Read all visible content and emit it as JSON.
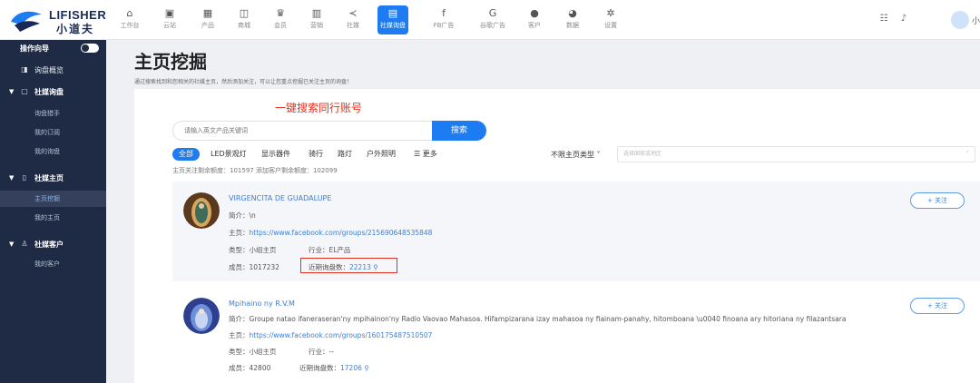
{
  "brand": {
    "name_en": "LIFISHER",
    "name_cn": "小道夫",
    "logo_color": "#1b2a55",
    "accent": "#1d7cf2"
  },
  "nav": [
    {
      "label": "工作台",
      "icon": "home-icon"
    },
    {
      "label": "云站",
      "icon": "monitor-icon"
    },
    {
      "label": "产品",
      "icon": "grid-icon"
    },
    {
      "label": "商城",
      "icon": "store-icon"
    },
    {
      "label": "会员",
      "icon": "crown-icon"
    },
    {
      "label": "营销",
      "icon": "bar-chart-icon"
    },
    {
      "label": "社媒",
      "icon": "share-icon"
    },
    {
      "label": "社媒询盘",
      "icon": "media-inquiry-icon",
      "active": true
    },
    {
      "label": "FB广告",
      "icon": "facebook-icon"
    },
    {
      "label": "谷歌广告",
      "icon": "google-icon"
    },
    {
      "label": "客户",
      "icon": "user-icon"
    },
    {
      "label": "数据",
      "icon": "pie-chart-icon"
    },
    {
      "label": "设置",
      "icon": "gear-icon"
    }
  ],
  "topright": {
    "avatar_name": "小"
  },
  "sidebar": {
    "guide_label": "操作向导",
    "overview": "询盘概览",
    "groups": [
      {
        "label": "社媒询盘",
        "items": [
          "询盘猎手",
          "我的订阅",
          "我的询盘"
        ]
      },
      {
        "label": "社媒主页",
        "items": [
          "主页挖掘",
          "我的主页"
        ],
        "active_item": "主页挖掘"
      },
      {
        "label": "社媒客户",
        "items": [
          "我的客户"
        ]
      }
    ]
  },
  "page": {
    "title": "主页挖掘",
    "description": "通过搜索找到和您相关的社媒主页，然后添加关注，可以让您重点挖掘已关注主页的询盘！"
  },
  "annotations": {
    "search": "一键搜索同行账号"
  },
  "search": {
    "placeholder": "请输入英文产品关键词",
    "button": "搜索"
  },
  "tags": [
    "全部",
    "LED景观灯",
    "显示器件",
    "骑行",
    "路灯",
    "户外照明",
    "更多"
  ],
  "filters": {
    "type_label": "不限主页类型",
    "region_placeholder": "选择国家或地区"
  },
  "quota": "主页关注剩余额度：101597   添加客户剩余额度：102099",
  "results": [
    {
      "name": "VIRGENCITA DE GUADALUPE",
      "intro_label": "简介：",
      "intro": "\\n",
      "homepage_label": "主页：",
      "homepage": "https://www.facebook.com/groups/215690648535848",
      "type_label": "类型：",
      "type": "小组主页",
      "industry_label": "行业：",
      "industry": "EL产品",
      "members_label": "成员：",
      "members": "1017232",
      "inquiry_label": "近期询盘数：",
      "inquiry_count": "22213",
      "follow": "+ 关注"
    },
    {
      "name": "Mpihaino ny R.V.M",
      "intro_label": "简介：",
      "intro": "Groupe natao ifaneraseran'ny mpihainon'ny Radio Vaovao Mahasoa. Hifampizarana izay mahasoa ny fiainam-panahy, hitomboana \\u0040 finoana ary hitoriana ny filazantsara",
      "homepage_label": "主页：",
      "homepage": "https://www.facebook.com/groups/160175487510507",
      "type_label": "类型：",
      "type": "小组主页",
      "industry_label": "行业：",
      "industry": "--",
      "members_label": "成员：",
      "members": "42800",
      "inquiry_label": "近期询盘数：",
      "inquiry_count": "17206",
      "follow": "+ 关注"
    }
  ]
}
